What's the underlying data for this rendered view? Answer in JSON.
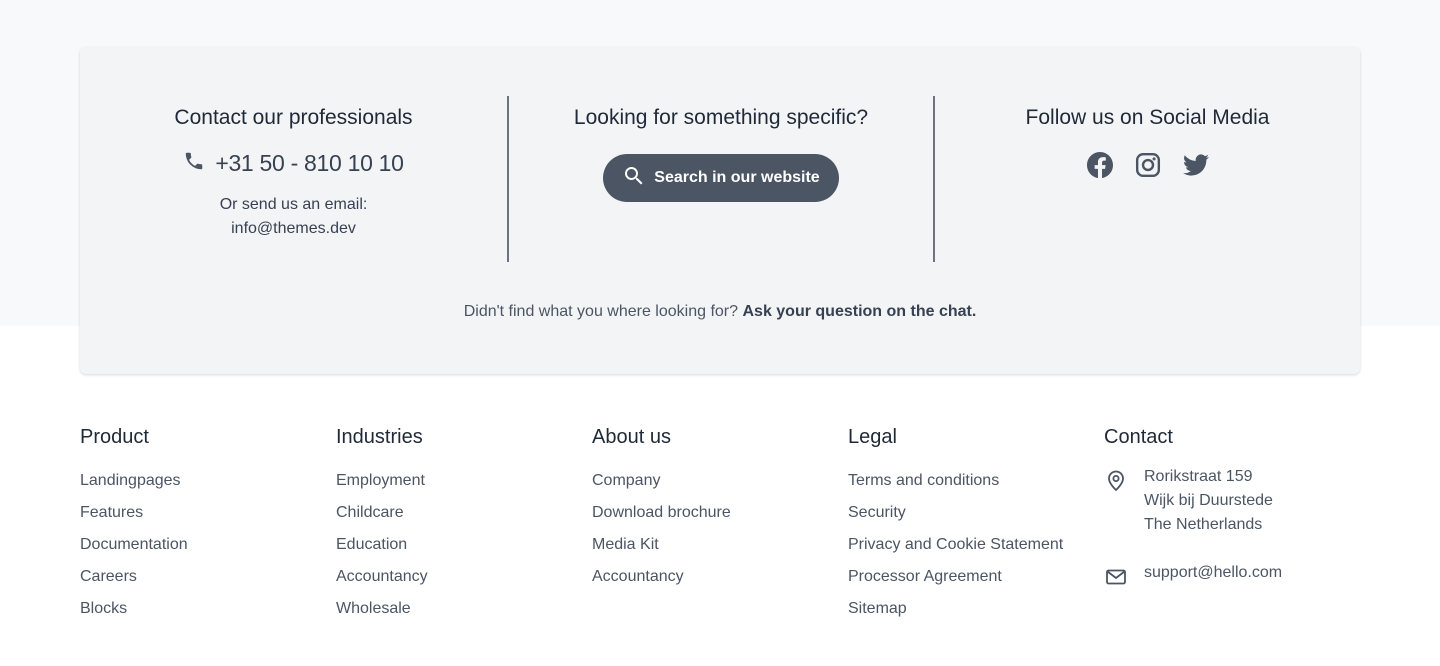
{
  "contact": {
    "heading": "Contact our professionals",
    "phone": "+31 50 - 810 10 10",
    "email_label": "Or send us an email:",
    "email": "info@themes.dev"
  },
  "search": {
    "heading": "Looking for something specific?",
    "button_label": "Search in our website"
  },
  "social": {
    "heading": "Follow us on Social Media",
    "icons": [
      "facebook-icon",
      "instagram-icon",
      "twitter-icon"
    ]
  },
  "chat": {
    "prefix": "Didn't find what you where looking for?",
    "link": "Ask your question on the chat."
  },
  "footer": {
    "product": {
      "title": "Product",
      "links": [
        "Landingpages",
        "Features",
        "Documentation",
        "Careers",
        "Blocks"
      ]
    },
    "industries": {
      "title": "Industries",
      "links": [
        "Employment",
        "Childcare",
        "Education",
        "Accountancy",
        "Wholesale"
      ]
    },
    "about": {
      "title": "About us",
      "links": [
        "Company",
        "Download brochure",
        "Media Kit",
        "Accountancy"
      ]
    },
    "legal": {
      "title": "Legal",
      "links": [
        "Terms and conditions",
        "Security",
        "Privacy and Cookie Statement",
        "Processor Agreement",
        "Sitemap"
      ]
    },
    "contact": {
      "title": "Contact",
      "address_line1": "Rorikstraat 159",
      "address_line2": "Wijk bij Duurstede",
      "address_line3": "The Netherlands",
      "email": "support@hello.com"
    }
  },
  "colors": {
    "button_bg": "#4b5563",
    "card_bg": "#f3f4f6",
    "text": "#374151"
  }
}
